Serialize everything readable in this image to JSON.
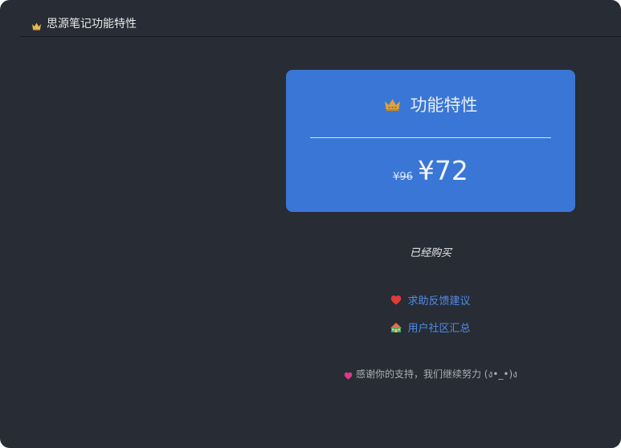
{
  "window": {
    "title": "思源笔记功能特性"
  },
  "card": {
    "title": "功能特性",
    "old_price": "¥96",
    "new_price": "¥72"
  },
  "status": {
    "purchased": "已经购买"
  },
  "links": {
    "help": "求助反馈建议",
    "community": "用户社区汇总"
  },
  "footer": {
    "thanks": "感谢你的支持，我们继续努力 (ง•_•)ง"
  },
  "icons": {
    "title_icon": "crown-icon",
    "card_icon": "crown-icon",
    "help_icon": "heart-icon",
    "community_icon": "house-icon",
    "thanks_icon": "heart-icon"
  },
  "colors": {
    "background": "#282c34",
    "card": "#3a76d5",
    "link": "#4f8ce8",
    "heart_red": "#e23a3a",
    "heart_pink": "#d93a8c",
    "crown": "#e3a234"
  }
}
